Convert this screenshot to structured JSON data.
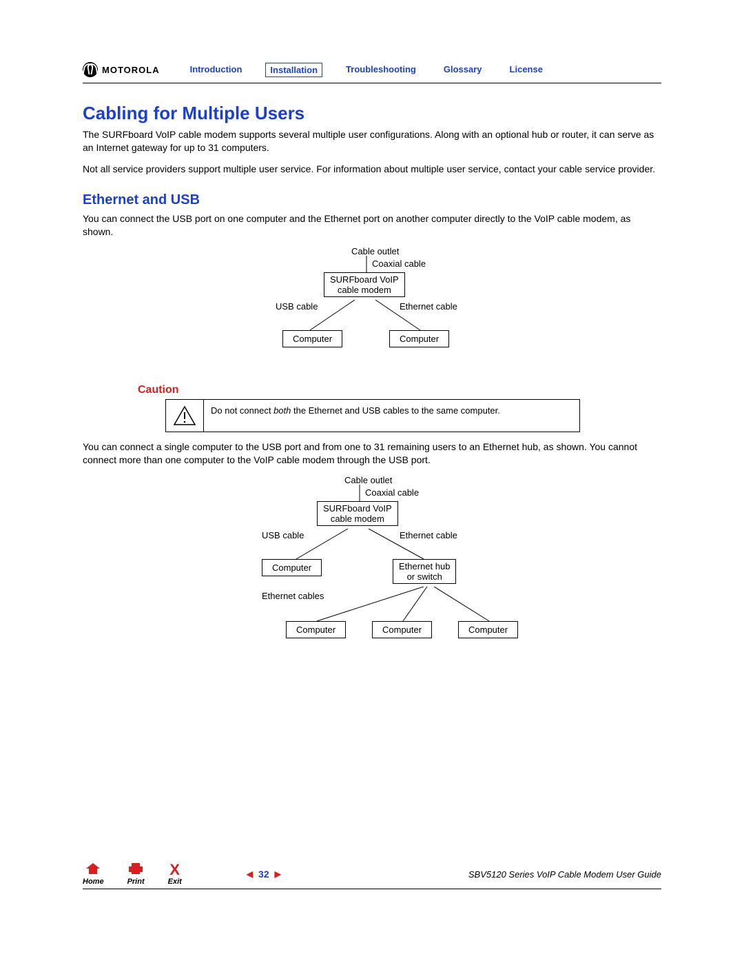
{
  "brand": "MOTOROLA",
  "nav": {
    "introduction": "Introduction",
    "installation": "Installation",
    "troubleshooting": "Troubleshooting",
    "glossary": "Glossary",
    "license": "License"
  },
  "h1": "Cabling for Multiple Users",
  "p1": "The SURFboard VoIP cable modem supports several multiple user configurations. Along with an optional hub or router, it can serve as an Internet gateway for up to 31 computers.",
  "p2": "Not all service providers support multiple user service. For information about multiple user service, contact your cable service provider.",
  "h2": "Ethernet and USB",
  "p3": "You can connect the USB port on one computer and the Ethernet port on another computer directly to the VoIP cable modem, as shown.",
  "diagram1": {
    "cable_outlet": "Cable outlet",
    "coaxial": "Coaxial cable",
    "modem": "SURFboard VoIP\ncable modem",
    "usb_cable": "USB cable",
    "eth_cable": "Ethernet cable",
    "computer_left": "Computer",
    "computer_right": "Computer"
  },
  "caution": {
    "heading": "Caution",
    "text_pre": "Do not connect ",
    "text_em": "both",
    "text_post": " the Ethernet and USB cables to the same computer."
  },
  "p4": "You can connect a single computer to the USB port and from one to 31 remaining users to an Ethernet hub, as shown. You cannot connect more than one computer to the VoIP cable modem through the USB port.",
  "diagram2": {
    "cable_outlet": "Cable outlet",
    "coaxial": "Coaxial cable",
    "modem": "SURFboard VoIP\ncable modem",
    "usb_cable": "USB cable",
    "eth_cable": "Ethernet cable",
    "computer_usb": "Computer",
    "hub": "Ethernet hub\nor switch",
    "eth_cables": "Ethernet cables",
    "computer_a": "Computer",
    "computer_b": "Computer",
    "computer_c": "Computer"
  },
  "footer": {
    "home": "Home",
    "print": "Print",
    "exit": "Exit",
    "page": "32",
    "guide": "SBV5120 Series VoIP Cable Modem User Guide"
  }
}
